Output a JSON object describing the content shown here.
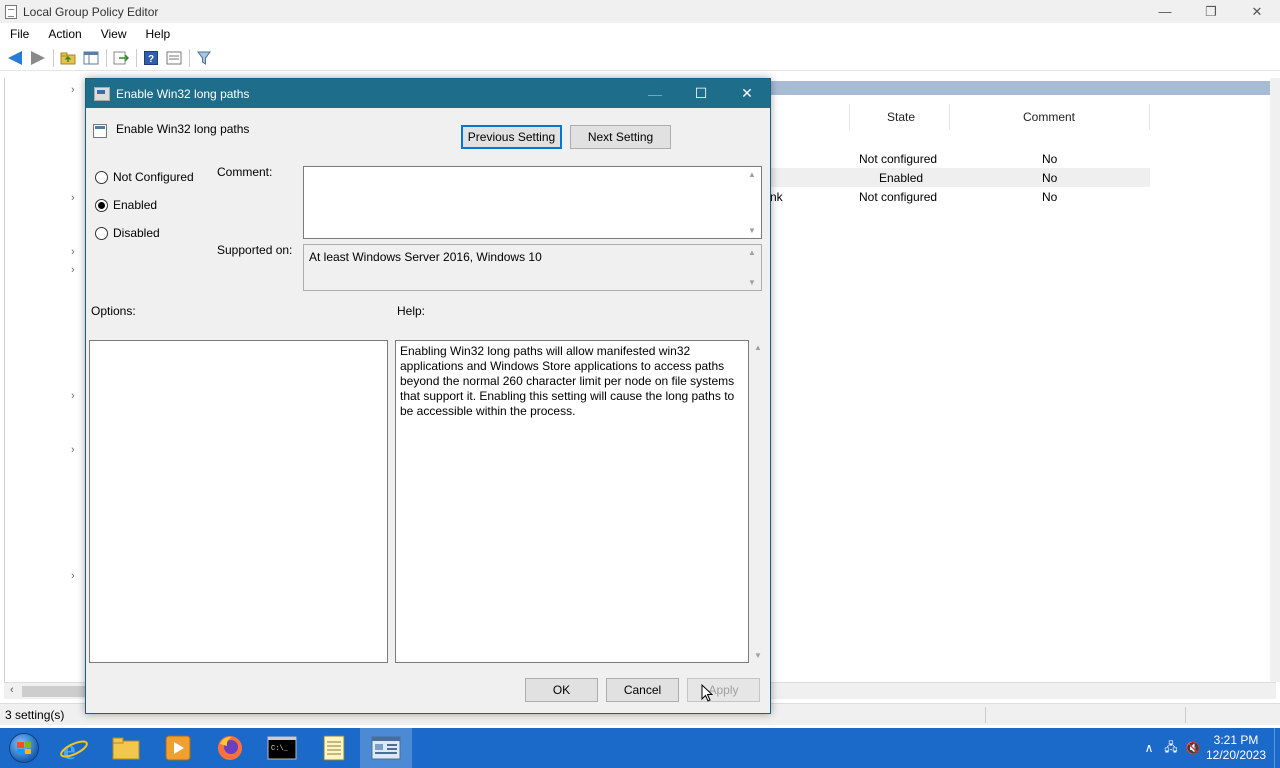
{
  "window": {
    "title": "Local Group Policy Editor",
    "controls": {
      "minimize": "—",
      "restore": "❐",
      "close": "✕"
    }
  },
  "menu": [
    "File",
    "Action",
    "View",
    "Help"
  ],
  "list_pane": {
    "columns": [
      "State",
      "Comment"
    ],
    "rows": [
      {
        "name_fragment": "",
        "state": "Not configured",
        "comment": "No",
        "selected": false
      },
      {
        "name_fragment": "",
        "state": "Enabled",
        "comment": "No",
        "selected": true
      },
      {
        "name_fragment": "nk",
        "state": "Not configured",
        "comment": "No",
        "selected": false
      }
    ]
  },
  "statusbar": {
    "text": "3 setting(s)"
  },
  "dialog": {
    "title": "Enable Win32 long paths",
    "setting_name": "Enable Win32 long paths",
    "previous_label": "Previous Setting",
    "next_label": "Next Setting",
    "radios": [
      {
        "label": "Not Configured",
        "checked": false
      },
      {
        "label": "Enabled",
        "checked": true
      },
      {
        "label": "Disabled",
        "checked": false
      }
    ],
    "comment_label": "Comment:",
    "comment_value": "",
    "supported_label": "Supported on:",
    "supported_value": "At least Windows Server 2016, Windows 10",
    "options_label": "Options:",
    "help_label": "Help:",
    "help_text": "Enabling Win32 long paths will allow manifested win32 applications and Windows Store applications to access paths beyond the normal 260 character limit per node on file systems that support it.  Enabling this setting will cause the long paths to be accessible within the process.",
    "ok_label": "OK",
    "cancel_label": "Cancel",
    "apply_label": "Apply"
  },
  "taskbar": {
    "apps": [
      "internet-explorer",
      "file-explorer",
      "media-player",
      "firefox",
      "command-prompt",
      "notepad",
      "group-policy-editor"
    ],
    "clock_time": "3:21 PM",
    "clock_date": "12/20/2023"
  },
  "colors": {
    "dialog_title_bg": "#1e6d8b",
    "taskbar_bg": "#1b69c9",
    "focus_border": "#0078d7",
    "list_header_strip": "#a7bcd4"
  }
}
